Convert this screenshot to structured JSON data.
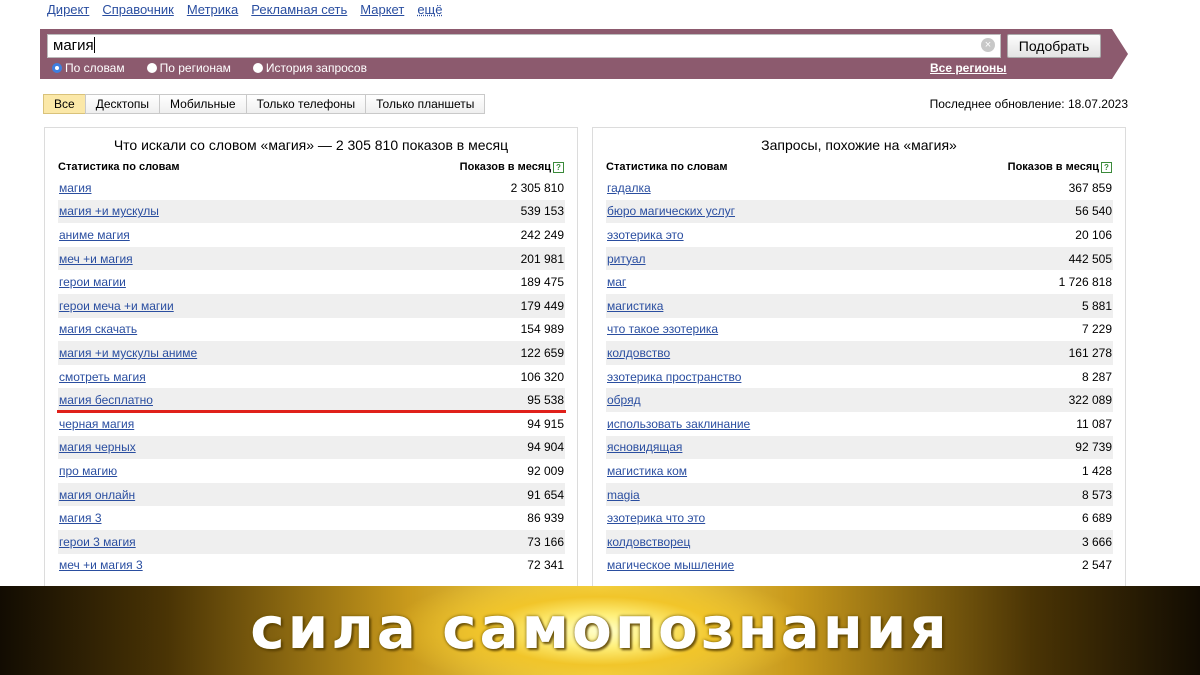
{
  "nav": {
    "items": [
      "Директ",
      "Справочник",
      "Метрика",
      "Рекламная сеть",
      "Маркет"
    ],
    "more": "ещё"
  },
  "search": {
    "value": "магия",
    "submit_label": "Подобрать",
    "radios": [
      "По словам",
      "По регионам",
      "История запросов"
    ],
    "selected_radio": "По словам",
    "all_regions": "Все регионы"
  },
  "tabs": {
    "items": [
      "Все",
      "Десктопы",
      "Мобильные",
      "Только телефоны",
      "Только планшеты"
    ],
    "active": "Все"
  },
  "last_update": "Последнее обновление: 18.07.2023",
  "left_panel": {
    "title": "Что искали со словом «магия» — 2 305 810 показов в месяц",
    "col_query": "Статистика по словам",
    "col_count": "Показов в месяц",
    "rows": [
      {
        "q": "магия",
        "n": "2 305 810"
      },
      {
        "q": "магия +и мускулы",
        "n": "539 153"
      },
      {
        "q": "аниме магия",
        "n": "242 249"
      },
      {
        "q": "меч +и магия",
        "n": "201 981"
      },
      {
        "q": "герои магии",
        "n": "189 475"
      },
      {
        "q": "герои меча +и магии",
        "n": "179 449"
      },
      {
        "q": "магия скачать",
        "n": "154 989"
      },
      {
        "q": "магия +и мускулы аниме",
        "n": "122 659"
      },
      {
        "q": "смотреть магия",
        "n": "106 320"
      },
      {
        "q": "магия бесплатно",
        "n": "95 538"
      },
      {
        "q": "черная магия",
        "n": "94 915"
      },
      {
        "q": "магия черных",
        "n": "94 904"
      },
      {
        "q": "про магию",
        "n": "92 009"
      },
      {
        "q": "магия онлайн",
        "n": "91 654"
      },
      {
        "q": "магия 3",
        "n": "86 939"
      },
      {
        "q": "герои 3 магия",
        "n": "73 166"
      },
      {
        "q": "меч +и магия 3",
        "n": "72 341"
      }
    ]
  },
  "right_panel": {
    "title": "Запросы, похожие на «магия»",
    "col_query": "Статистика по словам",
    "col_count": "Показов в месяц",
    "rows": [
      {
        "q": "гадалка",
        "n": "367 859"
      },
      {
        "q": "бюро магических услуг",
        "n": "56 540"
      },
      {
        "q": "эзотерика это",
        "n": "20 106"
      },
      {
        "q": "ритуал",
        "n": "442 505"
      },
      {
        "q": "маг",
        "n": "1 726 818"
      },
      {
        "q": "магистика",
        "n": "5 881"
      },
      {
        "q": "что такое эзотерика",
        "n": "7 229"
      },
      {
        "q": "колдовство",
        "n": "161 278"
      },
      {
        "q": "эзотерика пространство",
        "n": "8 287"
      },
      {
        "q": "обряд",
        "n": "322 089"
      },
      {
        "q": "использовать заклинание",
        "n": "11 087"
      },
      {
        "q": "ясновидящая",
        "n": "92 739"
      },
      {
        "q": "магистика ком",
        "n": "1 428"
      },
      {
        "q": "magia",
        "n": "8 573"
      },
      {
        "q": "эзотерика что это",
        "n": "6 689"
      },
      {
        "q": "колдовстворец",
        "n": "3 666"
      },
      {
        "q": "магическое мышление",
        "n": "2 547"
      }
    ]
  },
  "banner": {
    "text": "сила самопознания"
  }
}
